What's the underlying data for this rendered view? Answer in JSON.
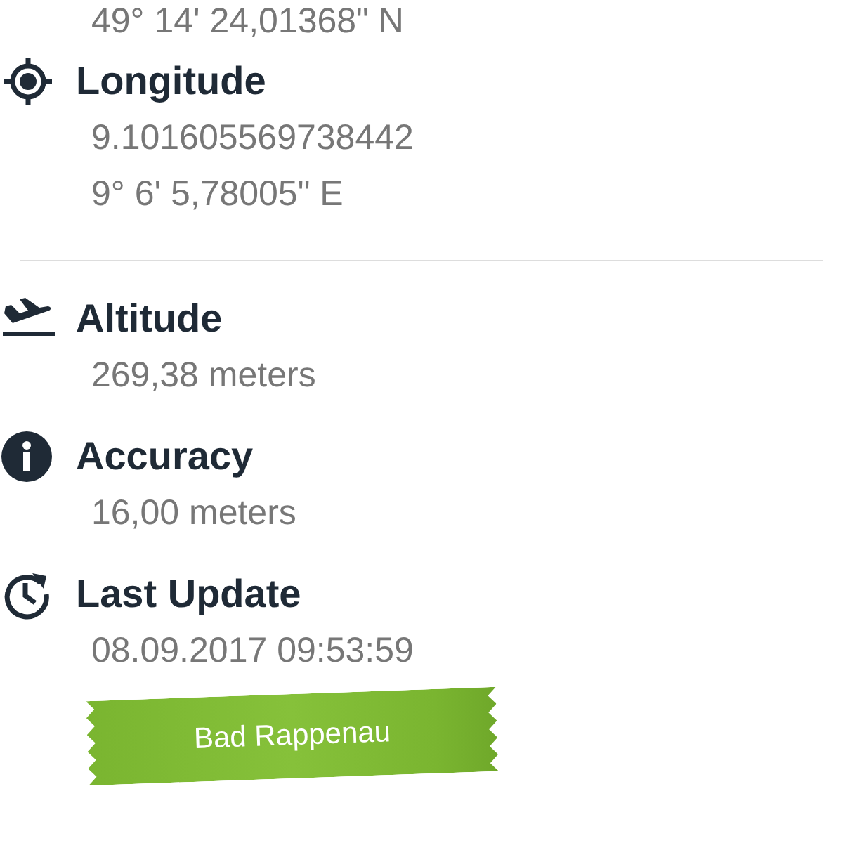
{
  "latitude_cut_line": "49° 14' 24,01368\" N",
  "location": [
    {
      "kind": "crosshair",
      "title": "Longitude",
      "values": [
        "9.101605569738442",
        "9° 6' 5,78005\" E"
      ]
    }
  ],
  "details": [
    {
      "kind": "plane",
      "title": "Altitude",
      "values": [
        "269,38 meters"
      ]
    },
    {
      "kind": "info",
      "title": "Accuracy",
      "values": [
        "16,00 meters"
      ]
    },
    {
      "kind": "clock",
      "title": "Last Update",
      "values": [
        "08.09.2017 09:53:59"
      ]
    }
  ],
  "place_tag": "Bad Rappenau"
}
